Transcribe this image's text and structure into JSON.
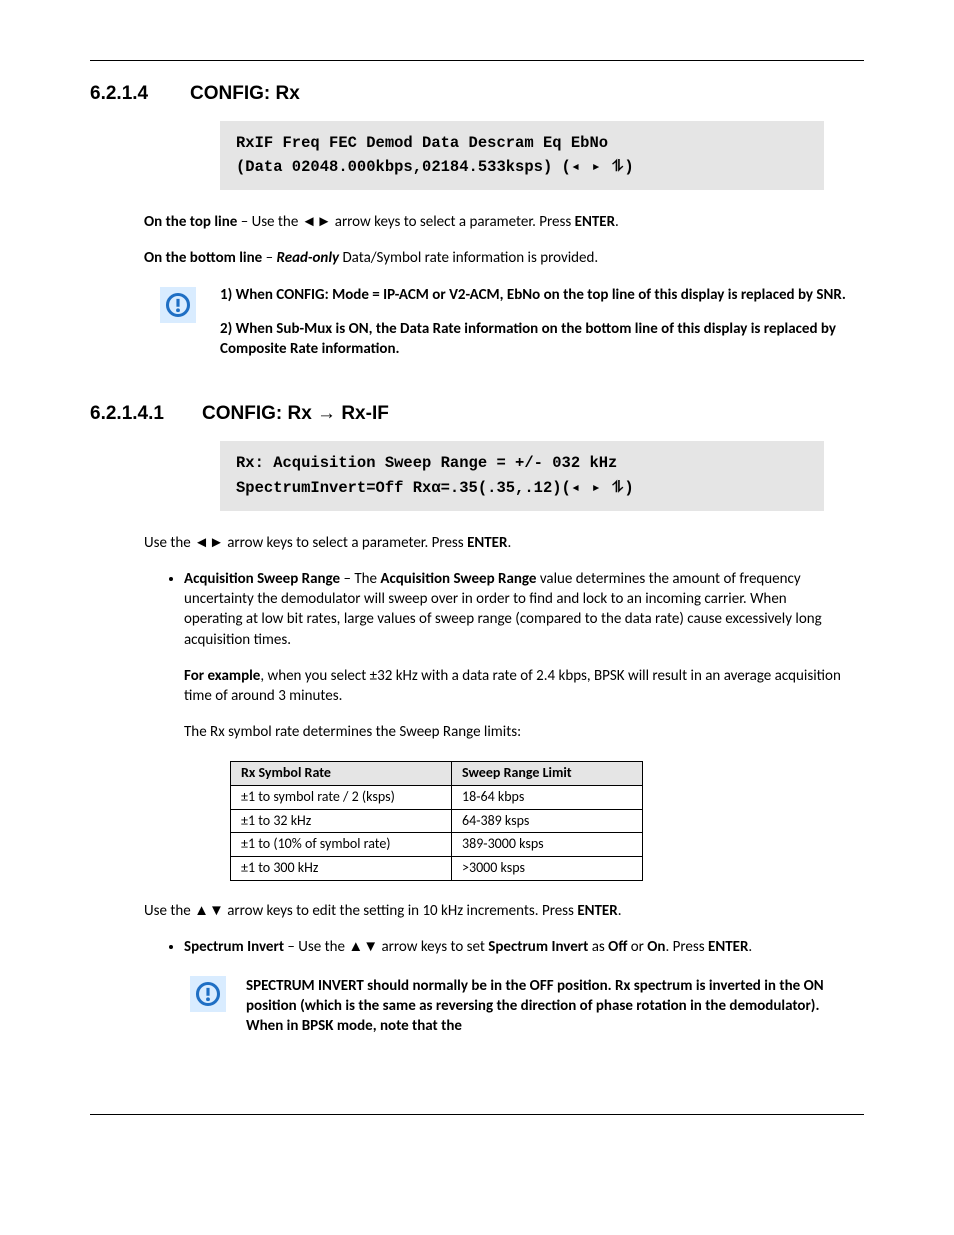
{
  "sec1": {
    "num": "6.2.1.4",
    "title": "CONFIG: Rx",
    "lcd_line1": "RxIF Freq FEC Demod Data Descram Eq EbNo",
    "lcd_line2_a": "(Data 02048.000kbps,02184.533ksps) (",
    "lcd_line2_b": ")",
    "p1_a": "On the top line",
    "p1_b": " – Use the ◄► arrow keys to select a parameter. Press ",
    "p1_c": "ENTER",
    "p1_d": ".",
    "p2_a": "On the bottom line",
    "p2_b": " – ",
    "p2_c": "Read-only",
    "p2_d": " Data/Symbol rate information is provided.",
    "note1": "1)  When CONFIG: Mode = IP-ACM or V2-ACM, EbNo on the top line of this display is replaced by SNR.",
    "note2": "2)  When Sub-Mux is ON, the Data Rate information on the bottom line of this display is replaced by Composite Rate information."
  },
  "sec2": {
    "num": "6.2.1.4.1",
    "title": "CONFIG: Rx → Rx-IF",
    "lcd_line1": "Rx: Acquisition Sweep Range = +/- 032 kHz",
    "lcd_line2_a": "SpectrumInvert=Off Rxα=.35(.35,.12)(",
    "lcd_line2_b": ")",
    "p1_a": "Use the ◄► arrow keys to select a parameter. Press ",
    "p1_b": "ENTER",
    "p1_c": ".",
    "b1_lead": "Acquisition Sweep Range ",
    "b1_a": " – The ",
    "b1_b": "Acquisition Sweep Range",
    "b1_c": " value determines the amount of frequency uncertainty the demodulator will sweep over in order to find and lock to an incoming carrier. When operating at low bit rates, large values of sweep range (compared to the data rate) cause excessively long acquisition times.",
    "b1_ex_a": "For example",
    "b1_ex_b": ", when you select ±32 kHz with a data rate of 2.4 kbps, BPSK will result in an average acquisition time of around 3 minutes.",
    "b1_tbl_intro": "The Rx symbol rate determines the Sweep Range limits:",
    "tbl": {
      "h1": "Rx Symbol Rate",
      "h2": "Sweep Range Limit",
      "rows": [
        {
          "c1": "±1 to symbol rate / 2 (ksps)",
          "c2": "18-64 kbps"
        },
        {
          "c1": "±1 to 32 kHz",
          "c2": "64-389 ksps"
        },
        {
          "c1": "±1 to (10% of symbol rate)",
          "c2": "389-3000 ksps"
        },
        {
          "c1": "±1 to 300 kHz",
          "c2": ">3000 ksps"
        }
      ]
    },
    "p_after_tbl_a": "Use the ▲▼ arrow keys to edit the setting in 10 kHz increments. Press ",
    "p_after_tbl_b": "ENTER",
    "p_after_tbl_c": ".",
    "b2_lead": "Spectrum Invert ",
    "b2_a": " – Use the ▲▼ arrow keys to set ",
    "b2_b": "Spectrum Invert",
    "b2_c": " as ",
    "b2_d": "Off",
    "b2_e": " or ",
    "b2_f": "On",
    "b2_g": ". Press ",
    "b2_h": "ENTER",
    "b2_i": ".",
    "note": "SPECTRUM INVERT should normally be in the OFF position. Rx spectrum is inverted in the ON position (which is the same as reversing the direction of phase rotation in the demodulator).  When in BPSK mode, note that the"
  }
}
